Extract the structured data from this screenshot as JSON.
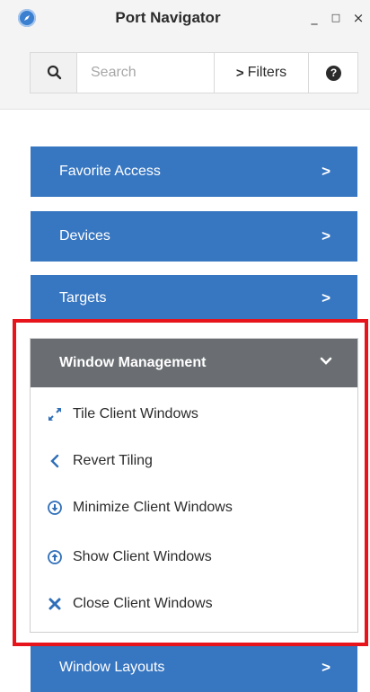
{
  "window": {
    "title": "Port Navigator",
    "minimize_glyph": "_",
    "maximize_glyph": "□",
    "close_glyph": "×"
  },
  "search": {
    "placeholder": "Search",
    "value": "",
    "filters_label": "Filters"
  },
  "nav": {
    "items": [
      {
        "label": "Favorite Access"
      },
      {
        "label": "Devices"
      },
      {
        "label": "Targets"
      }
    ],
    "window_management": {
      "label": "Window Management",
      "expanded": true,
      "items": [
        {
          "label": "Tile Client Windows",
          "icon": "tile-arrows-icon"
        },
        {
          "label": "Revert Tiling",
          "icon": "chevron-left-icon"
        },
        {
          "label": "Minimize Client Windows",
          "icon": "circle-arrow-down-icon"
        },
        {
          "label": "Show Client Windows",
          "icon": "circle-arrow-up-icon"
        },
        {
          "label": "Close Client Windows",
          "icon": "x-icon"
        }
      ]
    },
    "window_layouts": {
      "label": "Window Layouts"
    }
  },
  "colors": {
    "nav_blue": "#3776c1",
    "header_gray": "#6a6e72",
    "highlight_red": "#e8141c",
    "icon_blue": "#2f6fb8"
  }
}
